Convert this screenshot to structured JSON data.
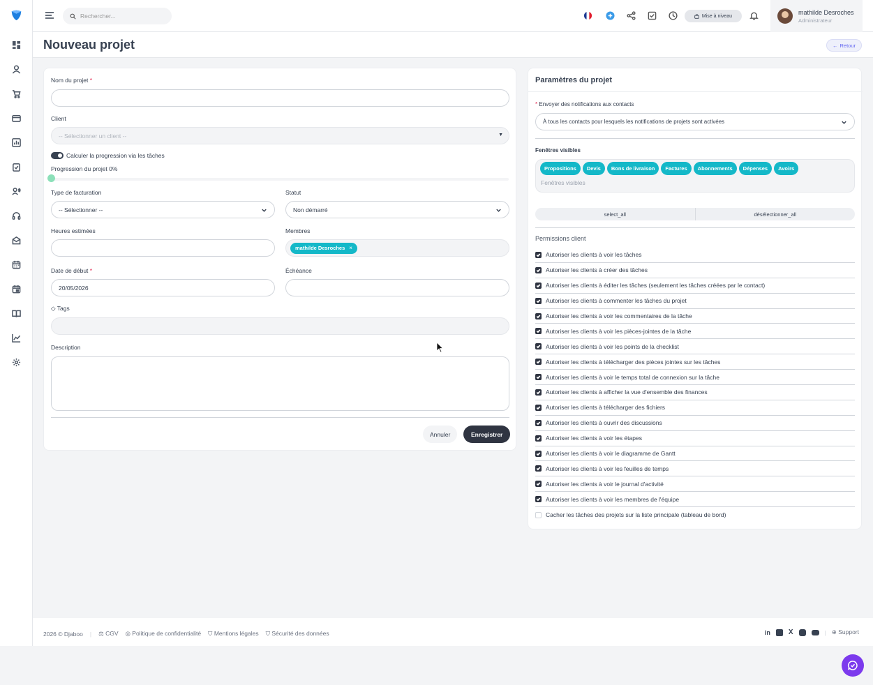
{
  "colors": {
    "accent": "#14b8c8",
    "dark": "#2f3441",
    "danger": "#e11d48",
    "purple": "#7c3aed"
  },
  "topbar": {
    "search_placeholder": "Rechercher...",
    "upgrade_label": "Mise à niveau",
    "user_name": "mathilde Desroches",
    "user_role": "Administrateur"
  },
  "page": {
    "title": "Nouveau projet",
    "back_label": "Retour"
  },
  "form": {
    "name_label": "Nom du projet",
    "required_mark": "*",
    "client_label": "Client",
    "client_placeholder": "-- Sélectionner un client --",
    "progress_toggle_label": "Calculer la progression via les tâches",
    "progress_label": "Progression du projet 0%",
    "progress_value": 0,
    "billing_label": "Type de facturation",
    "billing_value": "-- Sélectionner --",
    "status_label": "Statut",
    "status_value": "Non démarré",
    "hours_label": "Heures estimées",
    "members_label": "Membres",
    "member_chip": "mathilde Desroches",
    "start_date_label": "Date de début",
    "start_date_value": "20/05/2026",
    "deadline_label": "Échéance",
    "tags_label": "Tags",
    "description_label": "Description",
    "cancel_label": "Annuler",
    "save_label": "Enregistrer"
  },
  "settings": {
    "title": "Paramètres du projet",
    "notify_label": "Envoyer des notifications aux contacts",
    "notify_value": "À tous les contacts pour lesquels les notifications de projets sont activées",
    "visible_label": "Fenêtres visibles",
    "visible_chips": [
      "Propositions",
      "Devis",
      "Bons de livraison",
      "Factures",
      "Abonnements",
      "Dépenses",
      "Avoirs"
    ],
    "visible_placeholder": "Fenêtres visibles",
    "select_all": "select_all",
    "deselect_all": "désélectionner_all",
    "permissions_title": "Permissions client",
    "permissions": [
      {
        "label": "Autoriser les clients à voir les tâches",
        "checked": true
      },
      {
        "label": "Autoriser les clients à créer des tâches",
        "checked": true
      },
      {
        "label": "Autoriser les clients à éditer les tâches (seulement les tâches créées par le contact)",
        "checked": true
      },
      {
        "label": "Autoriser les clients à commenter les tâches du projet",
        "checked": true
      },
      {
        "label": "Autoriser les clients à voir les commentaires de la tâche",
        "checked": true
      },
      {
        "label": "Autoriser les clients à voir les pièces-jointes de la tâche",
        "checked": true
      },
      {
        "label": "Autoriser les clients à voir les points de la checklist",
        "checked": true
      },
      {
        "label": "Autoriser les clients à télécharger des pièces jointes sur les tâches",
        "checked": true
      },
      {
        "label": "Autoriser les clients à voir le temps total de connexion sur la tâche",
        "checked": true
      },
      {
        "label": "Autoriser les clients à afficher la vue d'ensemble des finances",
        "checked": true
      },
      {
        "label": "Autoriser les clients à télécharger des fichiers",
        "checked": true
      },
      {
        "label": "Autoriser les clients à ouvrir des discussions",
        "checked": true
      },
      {
        "label": "Autoriser les clients à voir les étapes",
        "checked": true
      },
      {
        "label": "Autoriser les clients à voir le diagramme de Gantt",
        "checked": true
      },
      {
        "label": "Autoriser les clients à voir les feuilles de temps",
        "checked": true
      },
      {
        "label": "Autoriser les clients à voir le journal d'activité",
        "checked": true
      },
      {
        "label": "Autoriser les clients à voir les membres de l'équipe",
        "checked": true
      },
      {
        "label": "Cacher les tâches des projets sur la liste principale (tableau de bord)",
        "checked": false
      }
    ]
  },
  "footer": {
    "copyright": "2026 © Djaboo",
    "cgv": "CGV",
    "privacy": "Politique de confidentialité",
    "legal": "Mentions légales",
    "security": "Sécurité des données",
    "support": "Support"
  }
}
